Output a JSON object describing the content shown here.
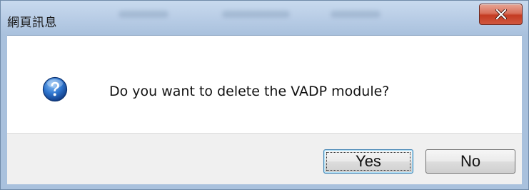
{
  "window": {
    "title": "網頁訊息",
    "close_icon": "close-icon"
  },
  "message": {
    "icon": "question-icon",
    "text": "Do you want to delete the VADP module?"
  },
  "buttons": {
    "yes_label": "Yes",
    "no_label": "No",
    "default": "Yes"
  },
  "colors": {
    "title_bar": "#b9cde6",
    "close_button": "#c43b22",
    "question_icon": "#1f5fb8",
    "footer": "#f0f0f0",
    "default_button_border": "#3c7fb1"
  }
}
